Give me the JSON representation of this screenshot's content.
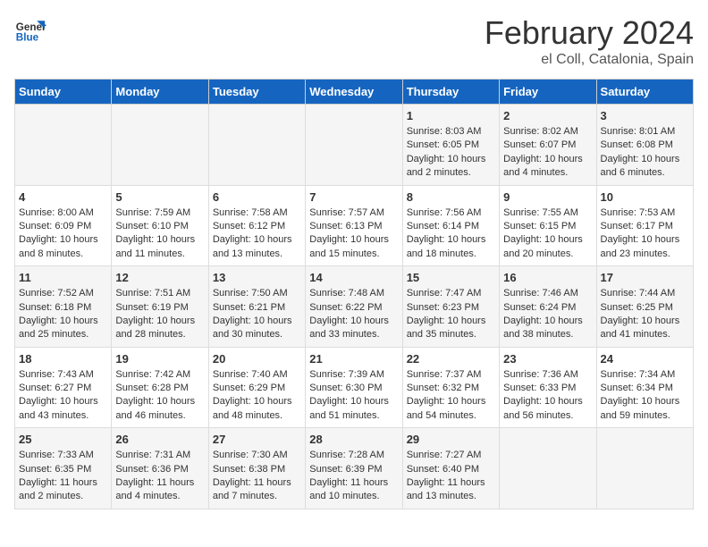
{
  "header": {
    "logo_general": "General",
    "logo_blue": "Blue",
    "title": "February 2024",
    "subtitle": "el Coll, Catalonia, Spain"
  },
  "weekdays": [
    "Sunday",
    "Monday",
    "Tuesday",
    "Wednesday",
    "Thursday",
    "Friday",
    "Saturday"
  ],
  "weeks": [
    [
      {
        "day": "",
        "info": ""
      },
      {
        "day": "",
        "info": ""
      },
      {
        "day": "",
        "info": ""
      },
      {
        "day": "",
        "info": ""
      },
      {
        "day": "1",
        "info": "Sunrise: 8:03 AM\nSunset: 6:05 PM\nDaylight: 10 hours\nand 2 minutes."
      },
      {
        "day": "2",
        "info": "Sunrise: 8:02 AM\nSunset: 6:07 PM\nDaylight: 10 hours\nand 4 minutes."
      },
      {
        "day": "3",
        "info": "Sunrise: 8:01 AM\nSunset: 6:08 PM\nDaylight: 10 hours\nand 6 minutes."
      }
    ],
    [
      {
        "day": "4",
        "info": "Sunrise: 8:00 AM\nSunset: 6:09 PM\nDaylight: 10 hours\nand 8 minutes."
      },
      {
        "day": "5",
        "info": "Sunrise: 7:59 AM\nSunset: 6:10 PM\nDaylight: 10 hours\nand 11 minutes."
      },
      {
        "day": "6",
        "info": "Sunrise: 7:58 AM\nSunset: 6:12 PM\nDaylight: 10 hours\nand 13 minutes."
      },
      {
        "day": "7",
        "info": "Sunrise: 7:57 AM\nSunset: 6:13 PM\nDaylight: 10 hours\nand 15 minutes."
      },
      {
        "day": "8",
        "info": "Sunrise: 7:56 AM\nSunset: 6:14 PM\nDaylight: 10 hours\nand 18 minutes."
      },
      {
        "day": "9",
        "info": "Sunrise: 7:55 AM\nSunset: 6:15 PM\nDaylight: 10 hours\nand 20 minutes."
      },
      {
        "day": "10",
        "info": "Sunrise: 7:53 AM\nSunset: 6:17 PM\nDaylight: 10 hours\nand 23 minutes."
      }
    ],
    [
      {
        "day": "11",
        "info": "Sunrise: 7:52 AM\nSunset: 6:18 PM\nDaylight: 10 hours\nand 25 minutes."
      },
      {
        "day": "12",
        "info": "Sunrise: 7:51 AM\nSunset: 6:19 PM\nDaylight: 10 hours\nand 28 minutes."
      },
      {
        "day": "13",
        "info": "Sunrise: 7:50 AM\nSunset: 6:21 PM\nDaylight: 10 hours\nand 30 minutes."
      },
      {
        "day": "14",
        "info": "Sunrise: 7:48 AM\nSunset: 6:22 PM\nDaylight: 10 hours\nand 33 minutes."
      },
      {
        "day": "15",
        "info": "Sunrise: 7:47 AM\nSunset: 6:23 PM\nDaylight: 10 hours\nand 35 minutes."
      },
      {
        "day": "16",
        "info": "Sunrise: 7:46 AM\nSunset: 6:24 PM\nDaylight: 10 hours\nand 38 minutes."
      },
      {
        "day": "17",
        "info": "Sunrise: 7:44 AM\nSunset: 6:25 PM\nDaylight: 10 hours\nand 41 minutes."
      }
    ],
    [
      {
        "day": "18",
        "info": "Sunrise: 7:43 AM\nSunset: 6:27 PM\nDaylight: 10 hours\nand 43 minutes."
      },
      {
        "day": "19",
        "info": "Sunrise: 7:42 AM\nSunset: 6:28 PM\nDaylight: 10 hours\nand 46 minutes."
      },
      {
        "day": "20",
        "info": "Sunrise: 7:40 AM\nSunset: 6:29 PM\nDaylight: 10 hours\nand 48 minutes."
      },
      {
        "day": "21",
        "info": "Sunrise: 7:39 AM\nSunset: 6:30 PM\nDaylight: 10 hours\nand 51 minutes."
      },
      {
        "day": "22",
        "info": "Sunrise: 7:37 AM\nSunset: 6:32 PM\nDaylight: 10 hours\nand 54 minutes."
      },
      {
        "day": "23",
        "info": "Sunrise: 7:36 AM\nSunset: 6:33 PM\nDaylight: 10 hours\nand 56 minutes."
      },
      {
        "day": "24",
        "info": "Sunrise: 7:34 AM\nSunset: 6:34 PM\nDaylight: 10 hours\nand 59 minutes."
      }
    ],
    [
      {
        "day": "25",
        "info": "Sunrise: 7:33 AM\nSunset: 6:35 PM\nDaylight: 11 hours\nand 2 minutes."
      },
      {
        "day": "26",
        "info": "Sunrise: 7:31 AM\nSunset: 6:36 PM\nDaylight: 11 hours\nand 4 minutes."
      },
      {
        "day": "27",
        "info": "Sunrise: 7:30 AM\nSunset: 6:38 PM\nDaylight: 11 hours\nand 7 minutes."
      },
      {
        "day": "28",
        "info": "Sunrise: 7:28 AM\nSunset: 6:39 PM\nDaylight: 11 hours\nand 10 minutes."
      },
      {
        "day": "29",
        "info": "Sunrise: 7:27 AM\nSunset: 6:40 PM\nDaylight: 11 hours\nand 13 minutes."
      },
      {
        "day": "",
        "info": ""
      },
      {
        "day": "",
        "info": ""
      }
    ]
  ]
}
